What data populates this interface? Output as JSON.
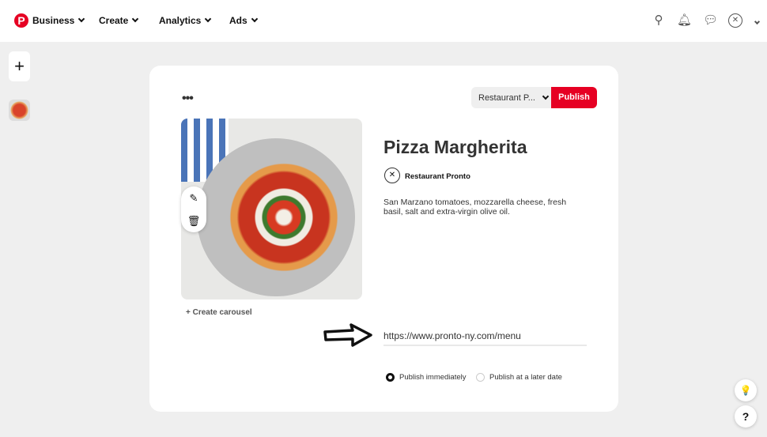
{
  "header": {
    "logo": "P",
    "nav": [
      {
        "label": "Business"
      },
      {
        "label": "Create"
      },
      {
        "label": "Analytics"
      },
      {
        "label": "Ads"
      }
    ],
    "icons": [
      "search-icon",
      "bell-icon",
      "chat-icon",
      "avatar",
      "chevron-down-icon"
    ]
  },
  "sidebar": {
    "add": "+"
  },
  "pin": {
    "more": "•••",
    "board": "Restaurant P...",
    "publish": "Publish",
    "title": "Pizza Margherita",
    "owner": "Restaurant Pronto",
    "description": "San Marzano tomatoes, mozzarella cheese, fresh basil, salt and extra-virgin olive oil.",
    "create_carousel": "+ Create carousel",
    "link": "https://www.pronto-ny.com/menu",
    "options": [
      {
        "label": "Publish immediately",
        "selected": true
      },
      {
        "label": "Publish at a later date",
        "selected": false
      }
    ]
  },
  "help": {
    "tips": "💡",
    "question": "?"
  },
  "colors": {
    "brand": "#e60023"
  }
}
